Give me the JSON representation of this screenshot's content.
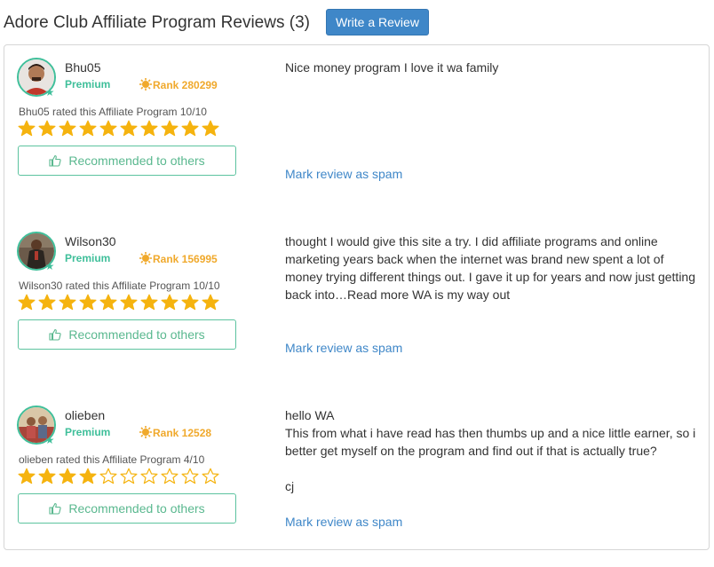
{
  "header": {
    "title": "Adore Club Affiliate Program Reviews (3)",
    "write_review_label": "Write a Review"
  },
  "reviews": [
    {
      "username": "Bhu05",
      "membership": "Premium",
      "rank": "Rank 280299",
      "rated_text": "Bhu05 rated this Affiliate Program 10/10",
      "rating": 10,
      "max_rating": 10,
      "recommend_label": "Recommended to others",
      "body": [
        "Nice money program I love it wa family"
      ],
      "spam_label": "Mark review as spam"
    },
    {
      "username": "Wilson30",
      "membership": "Premium",
      "rank": "Rank 156995",
      "rated_text": "Wilson30 rated this Affiliate Program 10/10",
      "rating": 10,
      "max_rating": 10,
      "recommend_label": "Recommended to others",
      "body": [
        "thought I would give this site a try. I did affiliate programs and online marketing years back when the internet was brand new spent a lot of money trying different things out. I gave it up for years and now just getting back into…Read more WA is my way out"
      ],
      "spam_label": "Mark review as spam"
    },
    {
      "username": "olieben",
      "membership": "Premium",
      "rank": "Rank 12528",
      "rated_text": "olieben rated this Affiliate Program 4/10",
      "rating": 4,
      "max_rating": 10,
      "recommend_label": "Recommended to others",
      "body": [
        "hello WA",
        "This from what i have read has then thumbs up and a nice little earner, so i better get myself on the program and find out if that is actually true?",
        "",
        "cj"
      ],
      "spam_label": "Mark review as spam"
    }
  ],
  "colors": {
    "accent_green": "#3fbf9a",
    "rank_orange": "#f0a92c",
    "link_blue": "#3f87c8",
    "star_fill": "#f5b30f"
  },
  "icons": {
    "rank": "sun-badge-icon",
    "recommend": "thumbs-up-icon",
    "star_full": "star-filled-icon",
    "star_empty": "star-outline-icon"
  }
}
